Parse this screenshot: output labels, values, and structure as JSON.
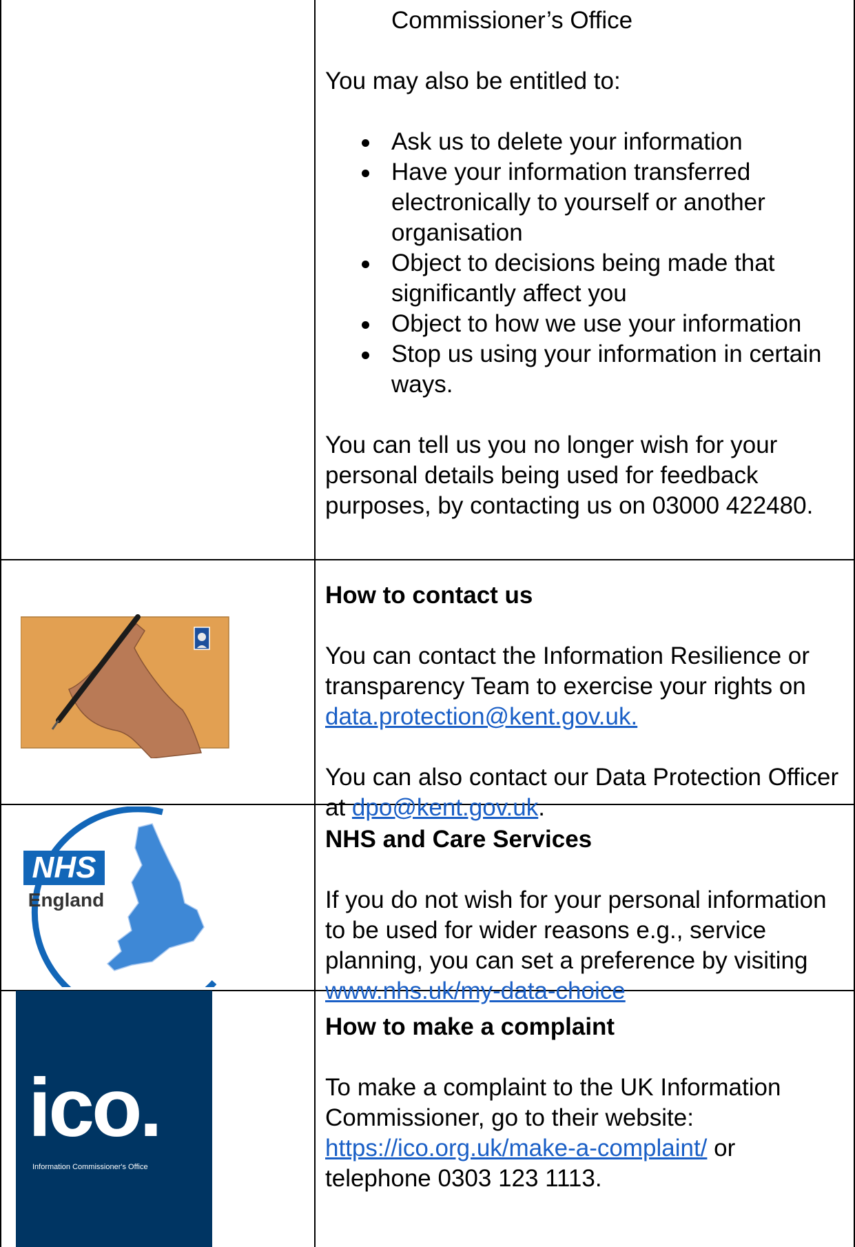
{
  "row1": {
    "continued_text": "Commissioner’s Office",
    "entitled_intro": "You may also be entitled to:",
    "rights": [
      "Ask us to delete your information",
      "Have your information transferred electronically to yourself or another organisation",
      "Object to decisions being made that significantly affect you",
      "Object to how we use your information",
      "Stop us using your information in certain ways."
    ],
    "feedback_text": "You can tell us you no longer wish for your personal details being used for feedback purposes, by contacting us on 03000 422480."
  },
  "contact": {
    "heading": "How to contact us",
    "text_before": "You can contact the Information Resilience or transparency Team to exercise your rights on ",
    "email_link": "data.protection@kent.gov.uk",
    "email_trail": ".",
    "dpo_before": "You can also contact our Data Protection Officer at ",
    "dpo_link": "dpo@kent.gov.uk",
    "dpo_after": "."
  },
  "nhs": {
    "heading": "NHS and Care Services",
    "text_before": "If you do not wish for your personal information to be used for wider reasons e.g., service planning, you can set a preference by visiting ",
    "link": "www.nhs.uk/my-data-choice",
    "logo_text_nhs": "NHS",
    "logo_text_england": "England"
  },
  "complaint": {
    "heading": "How to make a complaint",
    "text_before": "To make a complaint to the UK Information Commissioner, go to their website: ",
    "link": "https://ico.org.uk/make-a-complaint/",
    "text_after": " or telephone 0303 123 1113.",
    "logo_text": "ico.",
    "logo_subtext": "Information Commissioner's Office"
  },
  "colors": {
    "link": "#1a5fc6",
    "envelope": "#e2a052",
    "nhs_blue": "#1266b8",
    "ico_navy": "#003563"
  },
  "images": {
    "envelope_icon": "letter-writing-icon",
    "nhs_icon": "nhs-england-map-logo",
    "ico_icon": "ico-logo"
  }
}
